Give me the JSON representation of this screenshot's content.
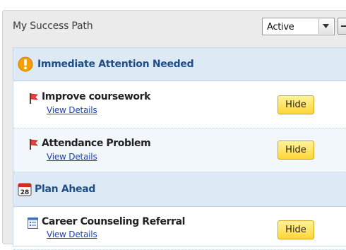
{
  "widget": {
    "title": "My Success Path",
    "filter": {
      "selected": "Active"
    }
  },
  "sections": [
    {
      "title": "Immediate Attention Needed",
      "icon": "exclamation-icon",
      "items": [
        {
          "title": "Improve coursework",
          "link": "View Details",
          "action": "Hide",
          "icon": "red-flag-icon"
        },
        {
          "title": "Attendance Problem",
          "link": "View Details",
          "action": "Hide",
          "icon": "red-flag-icon"
        }
      ]
    },
    {
      "title": "Plan Ahead",
      "icon": "calendar-icon",
      "calendar_day": "28",
      "items": [
        {
          "title": "Career Counseling Referral",
          "link": "View Details",
          "action": "Hide",
          "icon": "form-icon"
        }
      ]
    }
  ],
  "colors": {
    "section_bg": "#dde9f5",
    "section_title": "#1f4f86",
    "hide_button": "#ffd638",
    "link": "#1a3fc7"
  }
}
